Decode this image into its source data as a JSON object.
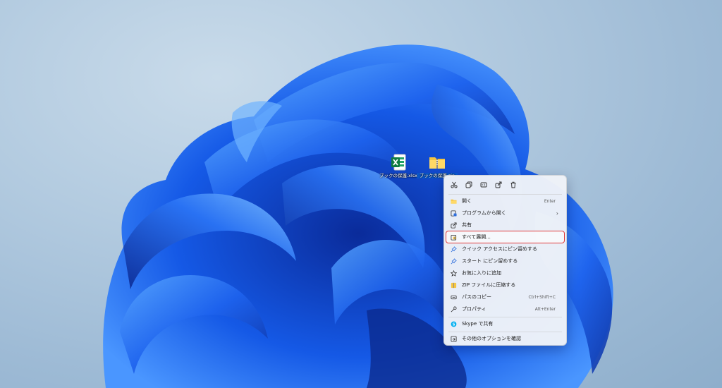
{
  "desktop": {
    "icons": [
      {
        "label": "ブックの保護.xlsx",
        "icon": "excel-icon"
      },
      {
        "label": "ブックの保護.zip",
        "icon": "zip-folder-icon"
      }
    ]
  },
  "context_menu": {
    "quick_actions": [
      {
        "name": "cut-icon"
      },
      {
        "name": "copy-icon"
      },
      {
        "name": "rename-icon"
      },
      {
        "name": "share-icon"
      },
      {
        "name": "delete-icon"
      }
    ],
    "items": [
      {
        "label": "開く",
        "shortcut": "Enter",
        "icon": "open-folder-icon"
      },
      {
        "label": "プログラムから開く",
        "submenu": "›",
        "icon": "open-with-icon"
      },
      {
        "label": "共有",
        "icon": "share-icon"
      },
      {
        "label": "すべて展開...",
        "icon": "extract-all-icon",
        "highlighted": true
      },
      {
        "label": "クイック アクセスにピン留めする",
        "icon": "pin-icon"
      },
      {
        "label": "スタート にピン留めする",
        "icon": "pin-icon"
      },
      {
        "label": "お気に入りに追加",
        "icon": "star-icon"
      },
      {
        "label": "ZIP ファイルに圧縮する",
        "icon": "zip-icon"
      },
      {
        "label": "パスのコピー",
        "shortcut": "Ctrl+Shift+C",
        "icon": "copy-path-icon"
      },
      {
        "label": "プロパティ",
        "shortcut": "Alt+Enter",
        "icon": "wrench-icon"
      },
      {
        "label": "Skype で共有",
        "icon": "skype-icon"
      },
      {
        "label": "その他のオプションを確認",
        "icon": "more-options-icon"
      }
    ]
  },
  "colors": {
    "highlight_border": "#e03a3a",
    "bloom_dark": "#0a2fa8",
    "bloom_light": "#3f8cff"
  }
}
